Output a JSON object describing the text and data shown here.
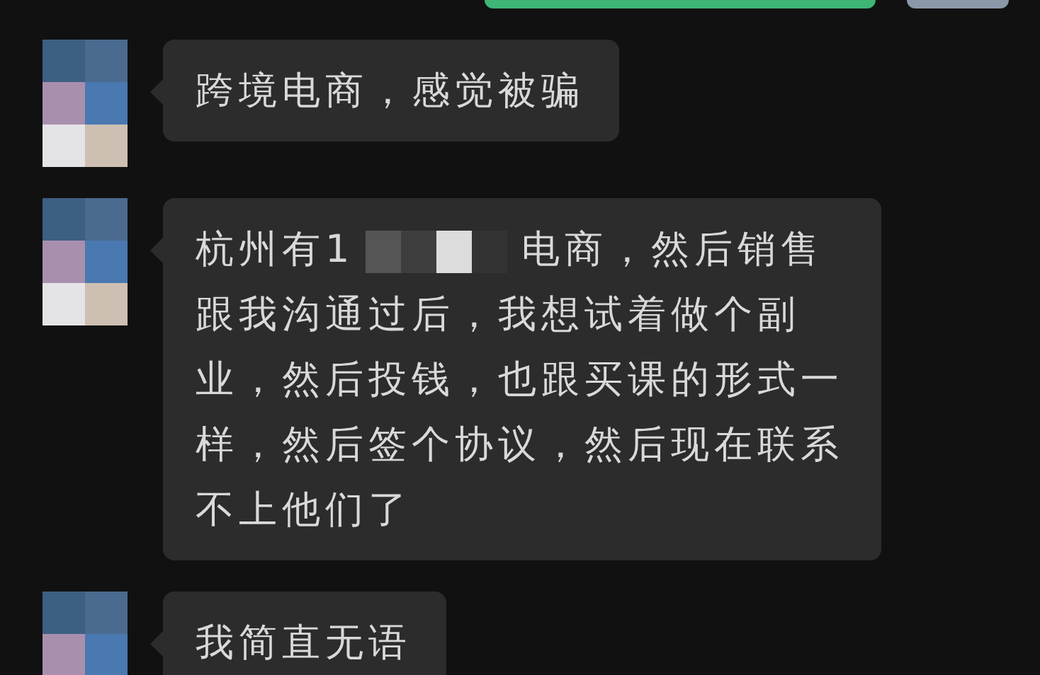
{
  "messages": [
    {
      "kind": "outgoing"
    },
    {
      "kind": "incoming",
      "parts": [
        {
          "kind": "text",
          "text": "跨境电商，感觉被骗"
        }
      ]
    },
    {
      "kind": "incoming",
      "parts": [
        {
          "kind": "text",
          "text": "杭州有1"
        },
        {
          "kind": "redacted"
        },
        {
          "kind": "text",
          "text": "电商，然后销售跟我沟通过后，我想试着做个副业，然后投钱，也跟买课的形式一样，然后签个协议，然后现在联系不上他们了"
        }
      ]
    },
    {
      "kind": "incoming",
      "parts": [
        {
          "kind": "text",
          "text": "我简直无语"
        }
      ]
    }
  ]
}
